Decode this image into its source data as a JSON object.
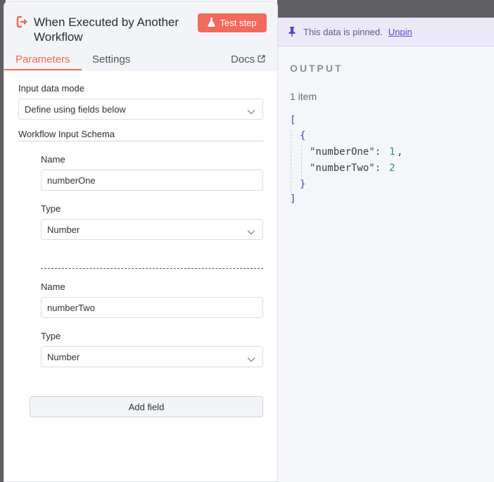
{
  "node": {
    "title": "When Executed by Another Workflow",
    "test_button": "Test step",
    "tabs": {
      "parameters": "Parameters",
      "settings": "Settings",
      "docs": "Docs"
    }
  },
  "form": {
    "input_data_mode_label": "Input data mode",
    "input_data_mode_value": "Define using fields below",
    "schema_title": "Workflow Input Schema",
    "fields": [
      {
        "name_label": "Name",
        "name_value": "numberOne",
        "type_label": "Type",
        "type_value": "Number"
      },
      {
        "name_label": "Name",
        "name_value": "numberTwo",
        "type_label": "Type",
        "type_value": "Number"
      }
    ],
    "add_field_button": "Add field"
  },
  "output": {
    "pinned_text": "This data is pinned.",
    "unpin_link": "Unpin",
    "title": "OUTPUT",
    "item_count": "1 item",
    "json_lines": {
      "open_array": "[",
      "open_object": "{",
      "key_one": "\"numberOne\":",
      "val_one": "1",
      "comma": ",",
      "key_two": "\"numberTwo\":",
      "val_two": "2",
      "close_object": "}",
      "close_array": "]"
    }
  },
  "colors": {
    "accent": "#ef6a5a",
    "test_button_bg": "#f26a5b",
    "pinned_bg": "#ece8f8",
    "link": "#5545d0",
    "json_number": "#1f9e5a"
  },
  "icons": {
    "node_icon": "sign-out-arrow-icon",
    "test_icon": "flask-icon",
    "docs_icon": "external-link-icon",
    "pin_icon": "pin-icon",
    "select_icon": "chevron-down-icon"
  }
}
